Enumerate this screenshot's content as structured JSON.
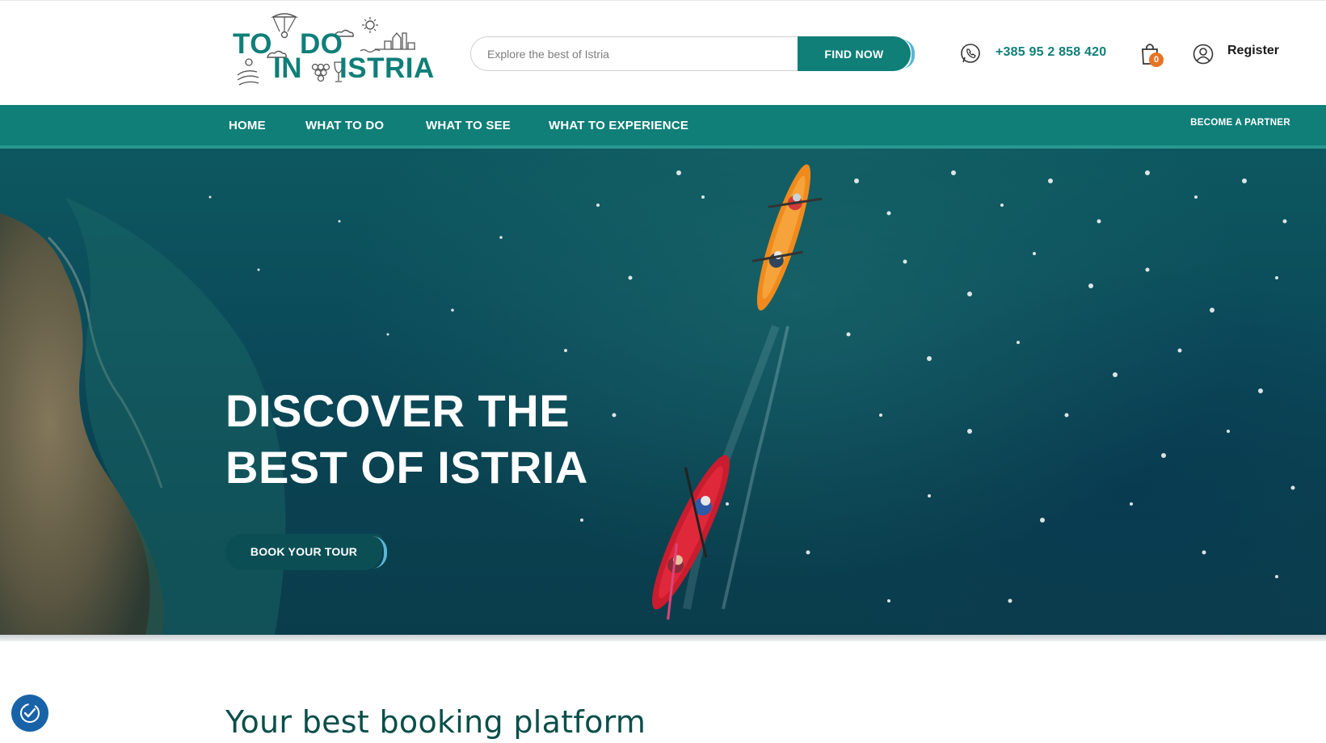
{
  "logo": {
    "line1_a": "TO",
    "line1_b": "DO",
    "line2_a": "IN",
    "line2_b": "ISTRIA"
  },
  "search": {
    "placeholder": "Explore the best of Istria",
    "button_label": "FIND NOW"
  },
  "contact": {
    "phone": "+385 95 2 858 420",
    "icon": "whatsapp-icon"
  },
  "cart": {
    "count": "0",
    "icon": "shopping-bag-icon"
  },
  "account": {
    "label": "Register",
    "icon": "user-circle-icon"
  },
  "nav": {
    "items": [
      {
        "label": "HOME"
      },
      {
        "label": "WHAT TO DO"
      },
      {
        "label": "WHAT TO SEE"
      },
      {
        "label": "WHAT TO EXPERIENCE"
      }
    ],
    "partner": "BECOME A PARTNER"
  },
  "hero": {
    "title_line1": "DISCOVER THE",
    "title_line2": "BEST OF ISTRIA",
    "cta": "BOOK YOUR TOUR"
  },
  "section": {
    "title": "Your best booking platform"
  },
  "colors": {
    "brand": "#0f7f78",
    "accent": "#5bb5d8",
    "badge": "#e67425",
    "cookie": "#1863a8"
  }
}
